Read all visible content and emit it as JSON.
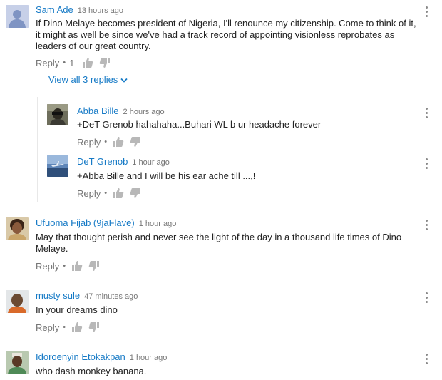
{
  "comments": {
    "sam": {
      "author": "Sam Ade",
      "time": "13 hours ago",
      "text": "If Dino Melaye becomes president of Nigeria, I'll renounce my citizenship. Come to think of it, it might as well be since we've had a track record of appointing visionless reprobates as leaders of our great country.",
      "reply_label": "Reply",
      "separator": "•",
      "like_count": "1",
      "view_replies_label": "View all 3 replies",
      "avatar_icon": "default-user-icon",
      "avatar_color": "#c7d0e8"
    },
    "abba": {
      "author": "Abba Bille",
      "time": "2 hours ago",
      "text": "+DeT Grenob  hahahaha...Buhari WL b ur headache forever",
      "reply_label": "Reply",
      "separator": "•"
    },
    "det": {
      "author": "DeT Grenob",
      "time": "1 hour ago",
      "text": "+Abba Bille and I will be his ear ache till ...,!",
      "reply_label": "Reply",
      "separator": "•"
    },
    "ufuoma": {
      "author": "Ufuoma Fijab (9jaFlave)",
      "time": "1 hour ago",
      "text": "May that thought perish and never see the light of the day in a thousand life times of Dino Melaye.",
      "reply_label": "Reply",
      "separator": "•"
    },
    "musty": {
      "author": "musty sule",
      "time": "47 minutes ago",
      "text": "In your dreams dino",
      "reply_label": "Reply",
      "separator": "•"
    },
    "idoroenyin": {
      "author": "Idoroenyin Etokakpan",
      "time": "1 hour ago",
      "text": "who dash monkey banana."
    }
  },
  "theme": {
    "link_color": "#167ac6",
    "meta_color": "#767676",
    "text_color": "#222222"
  }
}
